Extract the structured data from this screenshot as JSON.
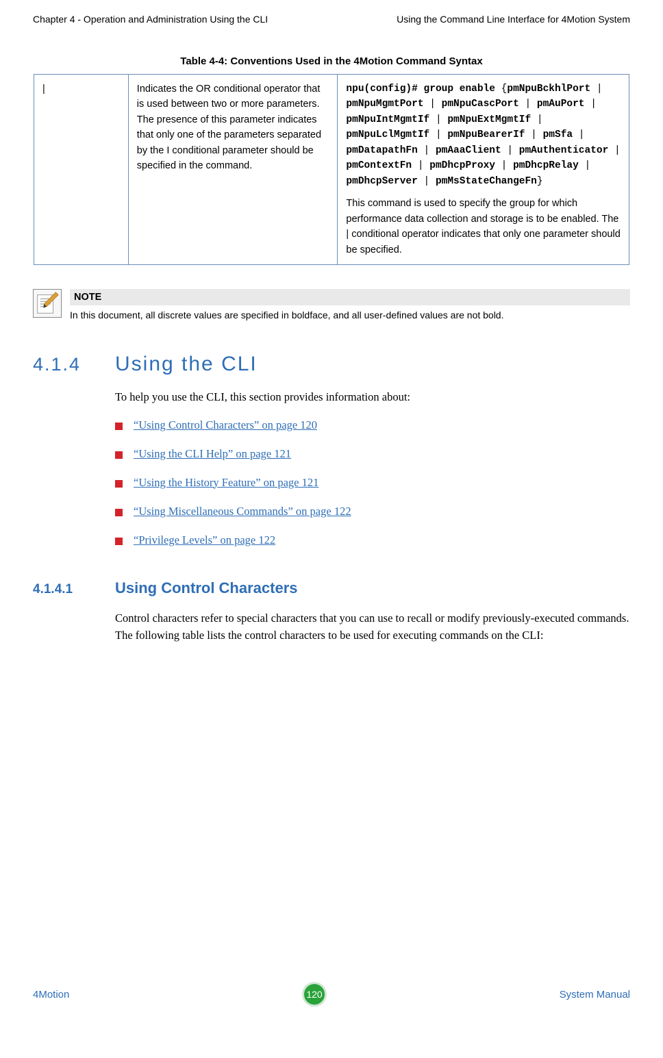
{
  "header": {
    "left": "Chapter 4 - Operation and Administration Using the CLI",
    "right": "Using the Command Line Interface for 4Motion System"
  },
  "table": {
    "title": "Table 4-4: Conventions Used in the 4Motion Command Syntax",
    "rows": [
      {
        "symbol": "|",
        "description": "Indicates the OR conditional operator that is used between two or more parameters. The presence of this parameter indicates that only one of the parameters separated by the I conditional parameter should be specified in the command.",
        "example_prefix": "npu(config)# group enable ",
        "example_open": "{",
        "example_params": [
          "pmNpuBckhlPort",
          "pmNpuMgmtPort",
          "pmNpuCascPort",
          "pmAuPort",
          "pmNpuIntMgmtIf",
          "pmNpuExtMgmtIf",
          "pmNpuLclMgmtIf",
          "pmNpuBearerIf",
          "pmSfa",
          "pmDatapathFn",
          "pmAaaClient",
          "pmAuthenticator",
          "pmContextFn",
          "pmDhcpProxy",
          "pmDhcpRelay",
          "pmDhcpServer",
          "pmMsStateChangeFn"
        ],
        "example_close": "}",
        "example_sep": " | ",
        "example_explain": "This command is used to specify the group for which performance data collection and storage is to be enabled. The | conditional operator indicates that only one parameter should be specified."
      }
    ]
  },
  "note": {
    "label": "NOTE",
    "body": "In this document, all discrete values are specified in boldface, and all user-defined values are not bold."
  },
  "section": {
    "num": "4.1.4",
    "title": "Using the CLI",
    "intro": "To help you use the CLI, this section provides information about:",
    "bullets": [
      "“Using Control Characters” on page 120",
      "“Using the CLI Help” on page 121",
      "“Using the History Feature” on page 121",
      "“Using Miscellaneous Commands” on page 122",
      "“Privilege Levels” on page 122"
    ]
  },
  "subsection": {
    "num": "4.1.4.1",
    "title": "Using Control Characters",
    "body": "Control characters refer to special characters that you can use to recall or modify previously-executed commands. The following table lists the control characters to be used for executing commands on the CLI:"
  },
  "footer": {
    "left": "4Motion",
    "page": "120",
    "right": "System Manual"
  }
}
